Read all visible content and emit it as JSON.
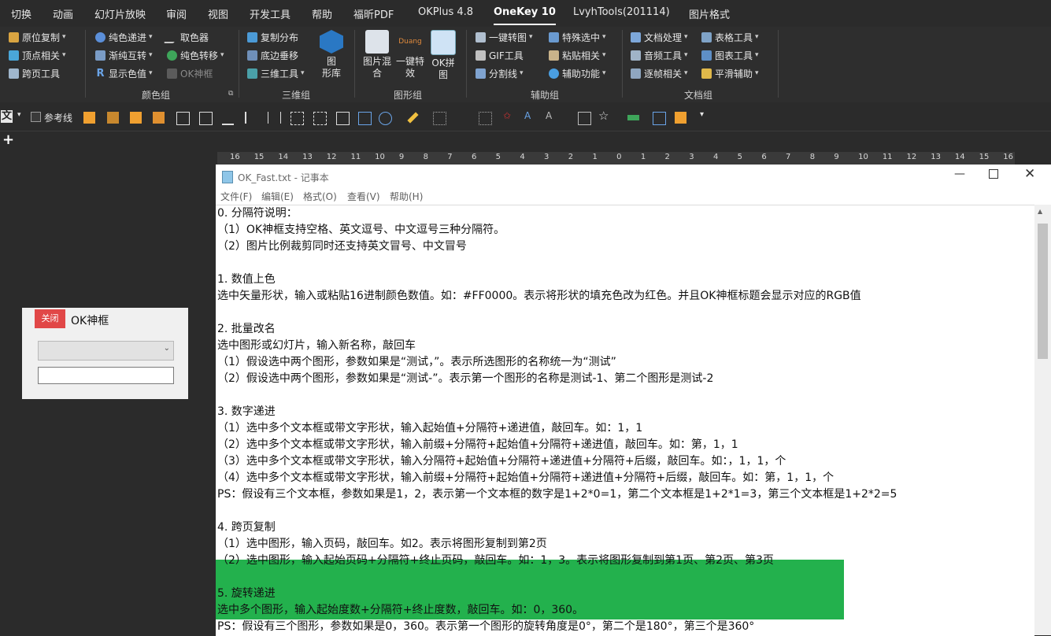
{
  "tabs": [
    "切换",
    "动画",
    "幻灯片放映",
    "审阅",
    "视图",
    "开发工具",
    "帮助",
    "福昕PDF",
    "OKPlus 4.8",
    "OneKey 10",
    "LvyhTools(201114)",
    "图片格式"
  ],
  "active_tab": "OneKey 10",
  "ribbon": {
    "col1": [
      "原位复制",
      "顶点相关",
      "跨页工具"
    ],
    "color_col1": [
      "纯色递进",
      "渐纯互转",
      "显示色值"
    ],
    "color_col2": [
      "取色器",
      "纯色转移",
      "OK神框"
    ],
    "three_d": [
      "复制分布",
      "底边垂移",
      "三维工具"
    ],
    "big_image_lib": "图\n形库",
    "big_mix": "图片混\n合",
    "big_effect": "一键特\n效",
    "big_ok_collage": "OK拼\n图",
    "duang_text": "Duang",
    "aux_col1": [
      "一键转图",
      "GIF工具",
      "分割线"
    ],
    "aux_col2": [
      "特殊选中",
      "粘贴相关",
      "辅助功能"
    ],
    "doc_col1": [
      "文档处理",
      "音频工具",
      "逐帧相关"
    ],
    "doc_col2": [
      "表格工具",
      "图表工具",
      "平滑辅助"
    ],
    "groups": [
      "颜色组",
      "三维组",
      "图形组",
      "辅助组",
      "文档组"
    ]
  },
  "qbar": {
    "lang_icon": "文",
    "ref_label": "参考线"
  },
  "plus": "+",
  "ruler": [
    "16",
    "15",
    "14",
    "13",
    "12",
    "11",
    "10",
    "9",
    "8",
    "7",
    "6",
    "5",
    "4",
    "3",
    "2",
    "1",
    "0",
    "1",
    "2",
    "3",
    "4",
    "5",
    "6",
    "7",
    "8",
    "9",
    "10",
    "11",
    "12",
    "13",
    "14",
    "15",
    "16"
  ],
  "okpanel": {
    "close": "关闭",
    "title": "OK神框"
  },
  "notepad": {
    "title": "OK_Fast.txt - 记事本",
    "menu": [
      "文件(F)",
      "编辑(E)",
      "格式(O)",
      "查看(V)",
      "帮助(H)"
    ],
    "lines": [
      "0. 分隔符说明：",
      "（1）OK神框支持空格、英文逗号、中文逗号三种分隔符。",
      "（2）图片比例裁剪同时还支持英文冒号、中文冒号",
      "",
      "1. 数值上色",
      "选中矢量形状，输入或粘贴16进制颜色数值。如：#FF0000。表示将形状的填充色改为红色。并且OK神框标题会显示对应的RGB值",
      "",
      "2. 批量改名",
      "选中图形或幻灯片，输入新名称，敲回车",
      "（1）假设选中两个图形，参数如果是“测试，”。表示所选图形的名称统一为“测试”",
      "（2）假设选中两个图形，参数如果是“测试-”。表示第一个图形的名称是测试-1、第二个图形是测试-2",
      "",
      "3. 数字递进",
      "（1）选中多个文本框或带文字形状，输入起始值+分隔符+递进值，敲回车。如：1，1",
      "（2）选中多个文本框或带文字形状，输入前缀+分隔符+起始值+分隔符+递进值，敲回车。如：第，1，1",
      "（3）选中多个文本框或带文字形状，输入分隔符+起始值+分隔符+递进值+分隔符+后缀，敲回车。如：，1，1，个",
      "（4）选中多个文本框或带文字形状，输入前缀+分隔符+起始值+分隔符+递进值+分隔符+后缀，敲回车。如：第，1，1，个",
      "PS：假设有三个文本框，参数如果是1，2，表示第一个文本框的数字是1+2*0=1，第二个文本框是1+2*1=3，第三个文本框是1+2*2=5",
      "",
      "4. 跨页复制",
      "（1）选中图形，输入页码，敲回车。如2。表示将图形复制到第2页",
      "（2）选中图形，输入起始页码+分隔符+终止页码，敲回车。如：1，3。表示将图形复制到第1页、第2页、第3页",
      "",
      "5. 旋转递进",
      "选中多个图形，输入起始度数+分隔符+终止度数，敲回车。如：0，360。",
      "PS：假设有三个图形，参数如果是0，360。表示第一个图形的旋转角度是0°，第二个是180°，第三个是360°"
    ]
  },
  "colors": {
    "highlight": "#23b14d",
    "close_red": "#e14747"
  }
}
